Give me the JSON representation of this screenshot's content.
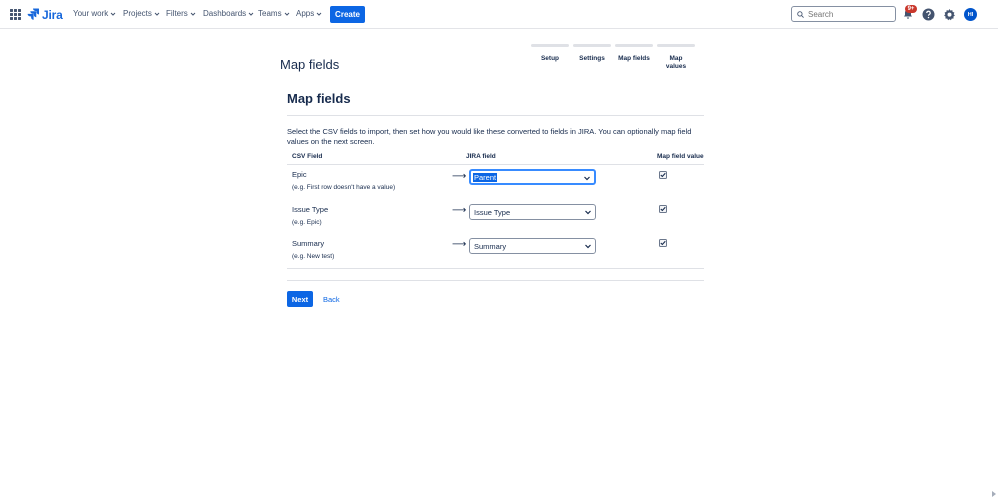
{
  "nav": {
    "logo_text": "Jira",
    "items": [
      {
        "label": "Your work"
      },
      {
        "label": "Projects"
      },
      {
        "label": "Filters"
      },
      {
        "label": "Dashboards"
      },
      {
        "label": "Teams"
      },
      {
        "label": "Apps"
      }
    ],
    "create_label": "Create",
    "search_placeholder": "Search",
    "notifications_badge": "9+",
    "avatar_initials": "HI",
    "brand_color": "#0c66e4"
  },
  "page": {
    "title": "Map fields",
    "steps": [
      {
        "label": "Setup"
      },
      {
        "label": "Settings"
      },
      {
        "label": "Map fields"
      },
      {
        "label": "Map values"
      }
    ]
  },
  "form": {
    "section_title": "Map fields",
    "description": "Select the CSV fields to import, then set how you would like these converted to fields in JIRA. You can optionally map field values on the next screen.",
    "columns": {
      "csv_field": "CSV Field",
      "jira_field": "JIRA field",
      "map_value": "Map field value"
    },
    "rows": [
      {
        "name": "Epic",
        "example": "(e.g. First row doesn't have a value)",
        "jira_field": "Parent",
        "map_value": true
      },
      {
        "name": "Issue Type",
        "example": "(e.g. Epic)",
        "jira_field": "Issue Type",
        "map_value": true
      },
      {
        "name": "Summary",
        "example": "(e.g. New test)",
        "jira_field": "Summary",
        "map_value": true
      }
    ],
    "next_label": "Next",
    "back_label": "Back"
  }
}
